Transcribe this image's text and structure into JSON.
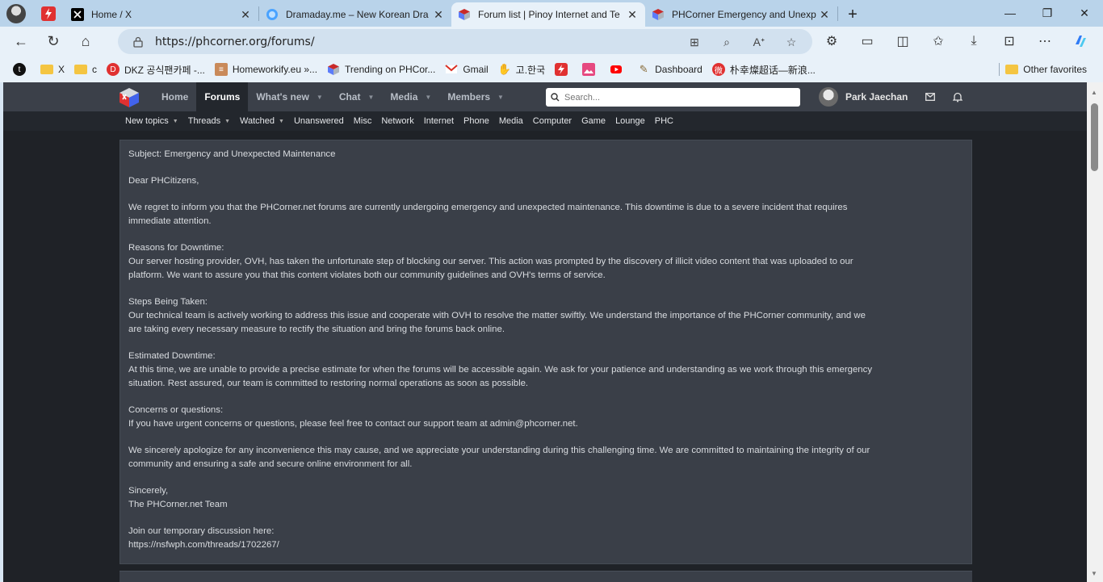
{
  "browser": {
    "tabs": [
      {
        "title": "Home / X",
        "icon": "x-logo-icon"
      },
      {
        "title": "Dramaday.me – New Korean Dra",
        "icon": "globe-icon"
      },
      {
        "title": "Forum list | Pinoy Internet and Te",
        "icon": "phcorner-logo-icon",
        "active": true
      },
      {
        "title": "PHCorner Emergency and Unexp",
        "icon": "phcorner-logo-icon"
      }
    ],
    "url": "https://phcorner.org/forums/",
    "favorites": [
      {
        "label": "",
        "icon": "threads-logo-icon"
      },
      {
        "label": "X",
        "icon": "folder-icon"
      },
      {
        "label": "c",
        "icon": "folder-icon"
      },
      {
        "label": "DKZ 공식팬카페 -...",
        "icon": "dkz-logo-icon"
      },
      {
        "label": "Homeworkify.eu »...",
        "icon": "homeworkify-logo-icon"
      },
      {
        "label": "Trending on PHCor...",
        "icon": "phcorner-logo-icon"
      },
      {
        "label": "Gmail",
        "icon": "gmail-icon"
      },
      {
        "label": "고.한국",
        "icon": "hand-icon"
      },
      {
        "label": "",
        "icon": "bolt-icon"
      },
      {
        "label": "",
        "icon": "image-icon"
      },
      {
        "label": "",
        "icon": "youtube-icon"
      },
      {
        "label": "Dashboard",
        "icon": "notepad-icon"
      },
      {
        "label": "朴幸燦超话—新浪...",
        "icon": "weibo-icon"
      }
    ],
    "other_favorites": "Other favorites"
  },
  "site": {
    "nav": [
      {
        "label": "Home",
        "caret": false
      },
      {
        "label": "Forums",
        "caret": false,
        "active": true
      },
      {
        "label": "What's new",
        "caret": true
      },
      {
        "label": "Chat",
        "caret": true
      },
      {
        "label": "Media",
        "caret": true
      },
      {
        "label": "Members",
        "caret": true
      }
    ],
    "search_placeholder": "Search...",
    "username": "Park Jaechan",
    "subnav": [
      {
        "label": "New topics",
        "caret": true
      },
      {
        "label": "Threads",
        "caret": true
      },
      {
        "label": "Watched",
        "caret": true
      },
      {
        "label": "Unanswered",
        "caret": false
      },
      {
        "label": "Misc",
        "caret": false
      },
      {
        "label": "Network",
        "caret": false
      },
      {
        "label": "Internet",
        "caret": false
      },
      {
        "label": "Phone",
        "caret": false
      },
      {
        "label": "Media",
        "caret": false
      },
      {
        "label": "Computer",
        "caret": false
      },
      {
        "label": "Game",
        "caret": false
      },
      {
        "label": "Lounge",
        "caret": false
      },
      {
        "label": "PHC",
        "caret": false
      }
    ]
  },
  "notice": {
    "paragraphs": [
      [
        "Subject: Emergency and Unexpected Maintenance"
      ],
      [
        "Dear PHCitizens,"
      ],
      [
        "We regret to inform you that the PHCorner.net forums are currently undergoing emergency and unexpected maintenance. This downtime is due to a severe incident that requires",
        "immediate attention."
      ],
      [
        "Reasons for Downtime:",
        "Our server hosting provider, OVH, has taken the unfortunate step of blocking our server. This action was prompted by the discovery of illicit video content that was uploaded to our",
        "platform. We want to assure you that this content violates both our community guidelines and OVH's terms of service."
      ],
      [
        "Steps Being Taken:",
        "Our technical team is actively working to address this issue and cooperate with OVH to resolve the matter swiftly. We understand the importance of the PHCorner community, and we",
        "are taking every necessary measure to rectify the situation and bring the forums back online."
      ],
      [
        "Estimated Downtime:",
        "At this time, we are unable to provide a precise estimate for when the forums will be accessible again. We ask for your patience and understanding as we work through this emergency",
        "situation. Rest assured, our team is committed to restoring normal operations as soon as possible."
      ],
      [
        "Concerns or questions:",
        "If you have urgent concerns or questions, please feel free to contact our support team at admin@phcorner.net."
      ],
      [
        "We sincerely apologize for any inconvenience this may cause, and we appreciate your understanding during this challenging time. We are committed to maintaining the integrity of our",
        "community and ensuring a safe and secure online environment for all."
      ],
      [
        "Sincerely,",
        "The PHCorner.net Team"
      ],
      [
        "Join our temporary discussion here:",
        "https://nsfwph.com/threads/1702267/"
      ]
    ]
  },
  "colors": {
    "site_header": "#3b4049",
    "site_subnav": "#23272d",
    "notice_bg": "#3a3f48",
    "tabstrip": "#b9d3ea"
  }
}
